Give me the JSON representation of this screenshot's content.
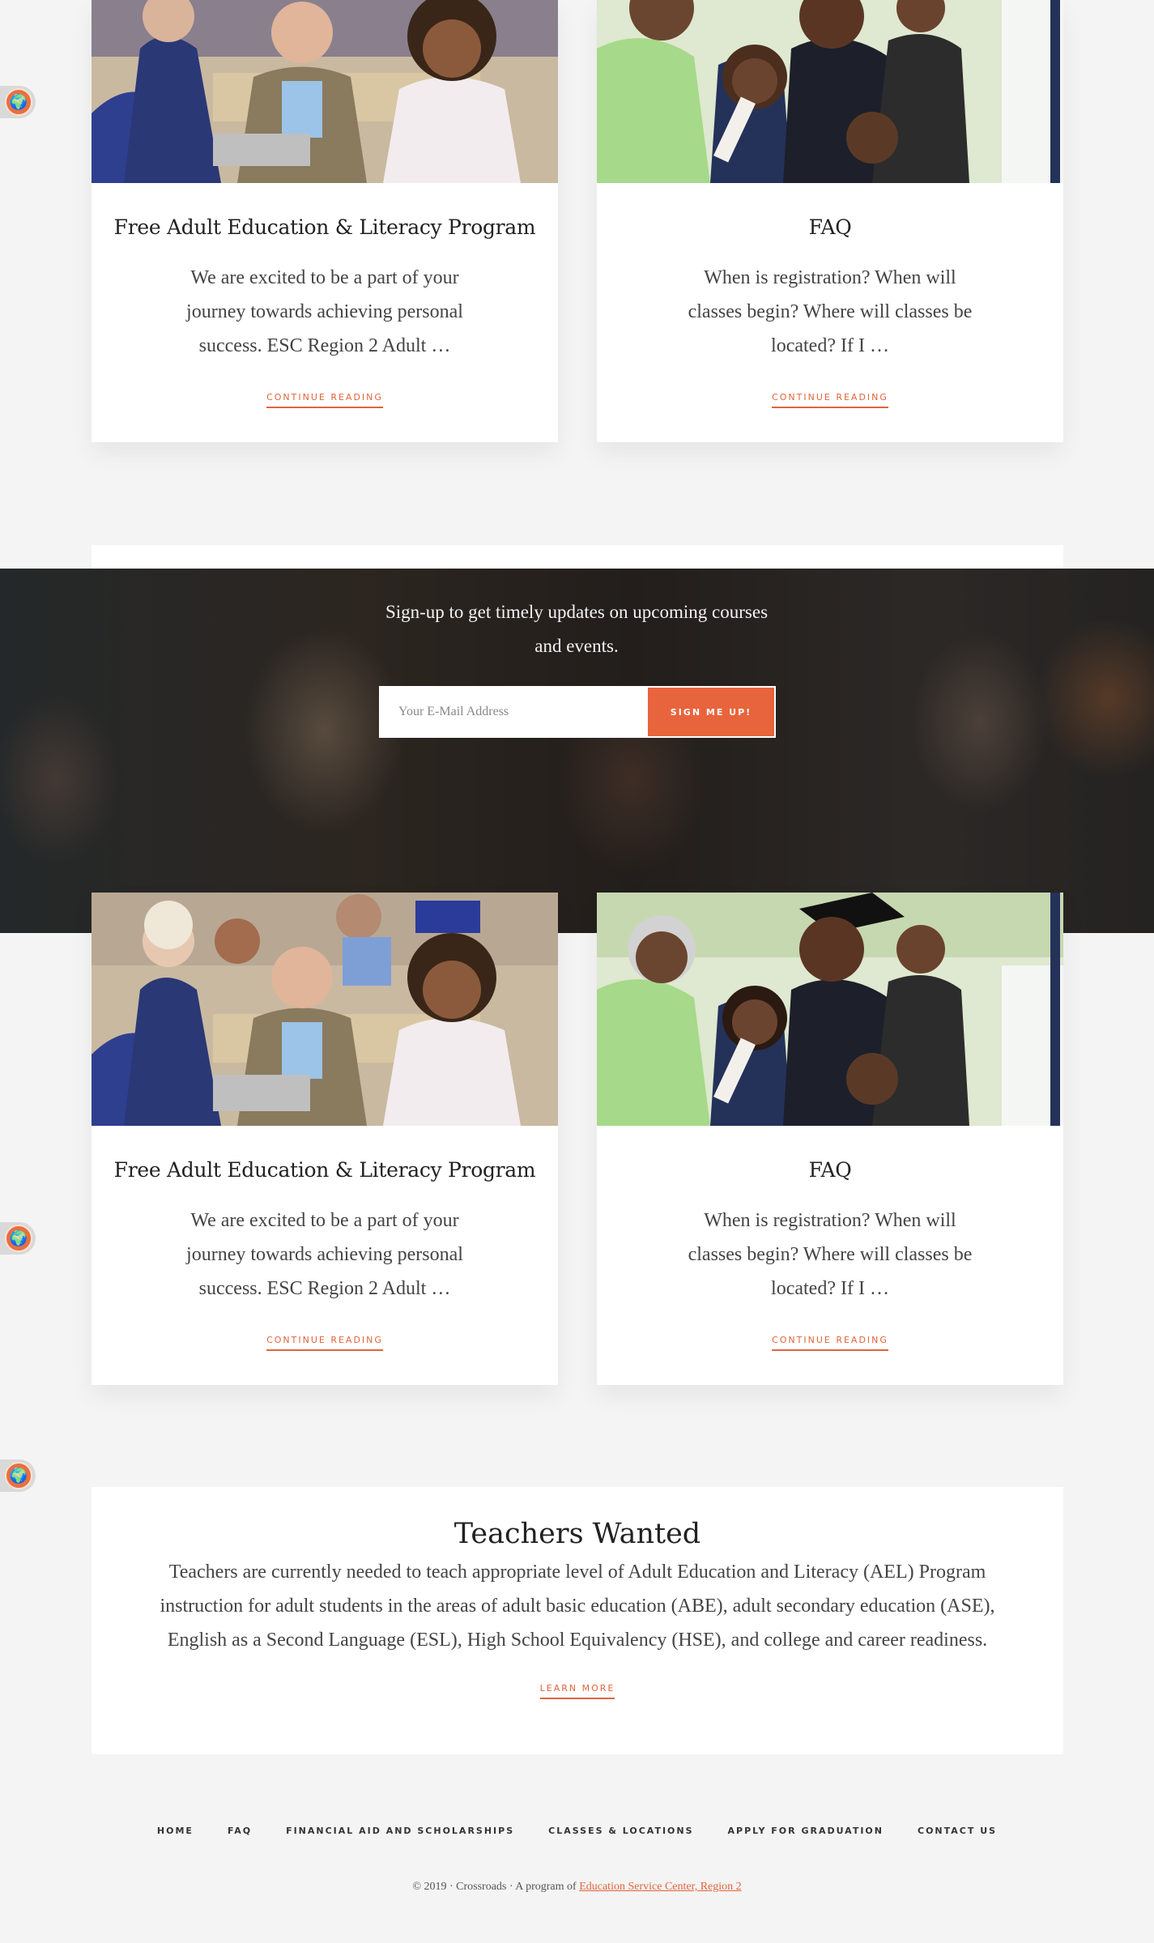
{
  "cards_top": [
    {
      "title": "Free Adult Education & Literacy Program",
      "excerpt": "We are excited to be a part of your journey towards achieving personal success. ESC Region 2 Adult …",
      "link": "CONTINUE READING",
      "image": "classroom-adults-photo"
    },
    {
      "title": "FAQ",
      "excerpt": "When is registration? When will classes begin? Where will classes be located? If I …",
      "link": "CONTINUE READING",
      "image": "graduation-family-photo"
    }
  ],
  "signup": {
    "text": "Sign-up to get timely updates on upcoming courses and events.",
    "email_placeholder": "Your E-Mail Address",
    "button": "SIGN ME UP!"
  },
  "cards_bottom": [
    {
      "title": "Free Adult Education & Literacy Program",
      "excerpt": "We are excited to be a part of your journey towards achieving personal success. ESC Region 2 Adult …",
      "link": "CONTINUE READING",
      "image": "classroom-adults-photo"
    },
    {
      "title": "FAQ",
      "excerpt": "When is registration? When will classes begin? Where will classes be located? If I …",
      "link": "CONTINUE READING",
      "image": "graduation-family-photo"
    }
  ],
  "teachers": {
    "title": "Teachers Wanted",
    "body": "Teachers are currently needed to teach appropriate level of Adult Education and Literacy (AEL) Program instruction for adult students in the areas of adult basic education (ABE), adult secondary education (ASE), English as a Second Language (ESL), High School Equivalency (HSE), and college and career readiness.",
    "link": "LEARN MORE"
  },
  "footer": {
    "nav": [
      "HOME",
      "FAQ",
      "FINANCIAL AID AND SCHOLARSHIPS",
      "CLASSES & LOCATIONS",
      "APPLY FOR GRADUATION",
      "CONTACT US"
    ],
    "copyright_prefix": "© 2019 · Crossroads · A program of ",
    "copyright_link": "Education Service Center, Region 2"
  },
  "side_icons": [
    "globe-icon",
    "globe-icon",
    "globe-icon",
    "globe-icon"
  ],
  "colors": {
    "accent": "#e8643c",
    "background": "#f4f4f4",
    "card": "#ffffff"
  }
}
